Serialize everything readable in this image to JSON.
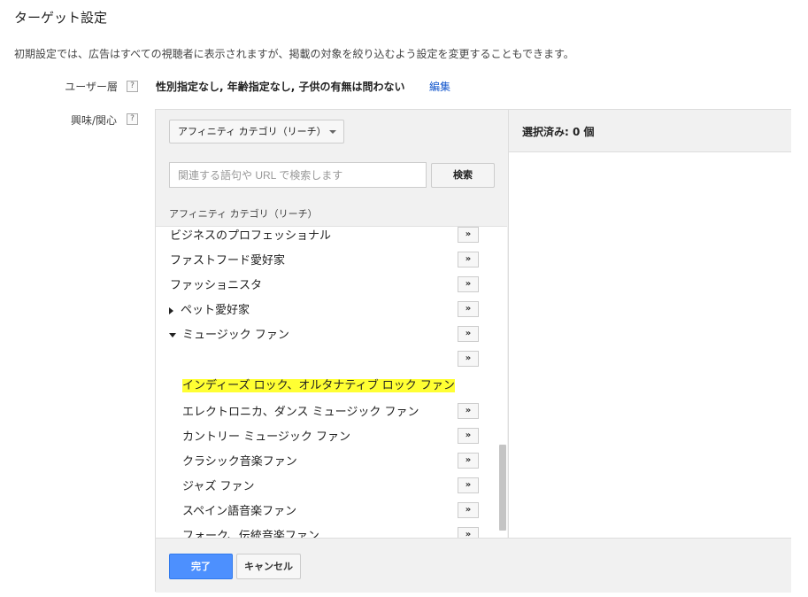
{
  "page": {
    "title": "ターゲット設定",
    "description": "初期設定では、広告はすべての視聴者に表示されますが、掲載の対象を絞り込むよう設定を変更することもできます。"
  },
  "user_layer": {
    "label": "ユーザー層",
    "help": "?",
    "value": "性別指定なし, 年齢指定なし, 子供の有無は問わない",
    "edit_label": "編集"
  },
  "interest": {
    "label": "興味/関心",
    "help": "?"
  },
  "selector": {
    "dropdown_value": "アフィニティ カテゴリ（リーチ）",
    "search_placeholder": "関連する語句や URL で検索します",
    "search_button": "検索",
    "section_header": "アフィニティ カテゴリ（リーチ）",
    "add_symbol": "»",
    "items": [
      {
        "label": "ビジネスのプロフェッショナル",
        "level": 0,
        "expander": "none",
        "add": true,
        "highlight": false
      },
      {
        "label": "ファストフード愛好家",
        "level": 0,
        "expander": "none",
        "add": true,
        "highlight": false
      },
      {
        "label": "ファッショニスタ",
        "level": 0,
        "expander": "none",
        "add": true,
        "highlight": false
      },
      {
        "label": "ペット愛好家",
        "level": 0,
        "expander": "collapsed",
        "add": true,
        "highlight": false
      },
      {
        "label": "ミュージック ファン",
        "level": 0,
        "expander": "expanded",
        "add": true,
        "highlight": false
      },
      {
        "label": "",
        "level": 1,
        "expander": "none",
        "add": true,
        "highlight": false
      },
      {
        "label": "インディーズ ロック、オルタナティブ ロック ファン",
        "level": 1,
        "expander": "none",
        "add": false,
        "highlight": true
      },
      {
        "label": "エレクトロニカ、ダンス ミュージック ファン",
        "level": 1,
        "expander": "none",
        "add": true,
        "highlight": false
      },
      {
        "label": "カントリー ミュージック ファン",
        "level": 1,
        "expander": "none",
        "add": true,
        "highlight": false
      },
      {
        "label": "クラシック音楽ファン",
        "level": 1,
        "expander": "none",
        "add": true,
        "highlight": false
      },
      {
        "label": "ジャズ ファン",
        "level": 1,
        "expander": "none",
        "add": true,
        "highlight": false
      },
      {
        "label": "スペイン語音楽ファン",
        "level": 1,
        "expander": "none",
        "add": true,
        "highlight": false
      },
      {
        "label": "フォーク、伝統音楽ファン",
        "level": 1,
        "expander": "none",
        "add": true,
        "highlight": false
      }
    ]
  },
  "selected": {
    "header": "選択済み: 0 個"
  },
  "footer": {
    "done_label": "完了",
    "cancel_label": "キャンセル"
  },
  "colors": {
    "highlight": "#ffff33",
    "primary_button": "#4d90fe",
    "link": "#1155cc"
  }
}
